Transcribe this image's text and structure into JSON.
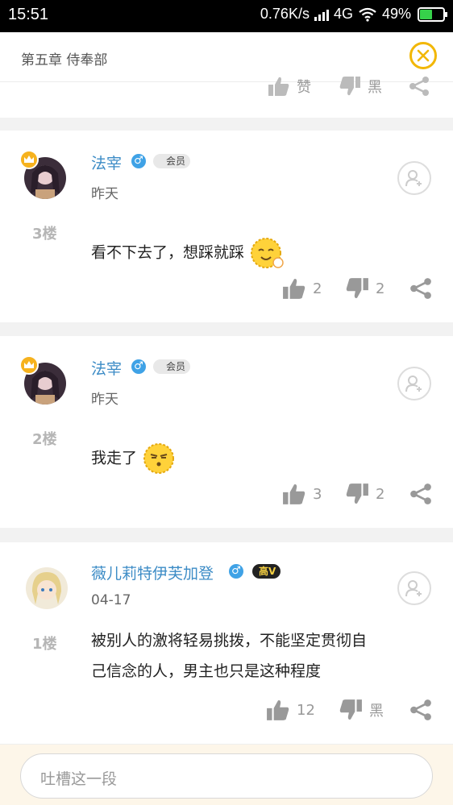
{
  "status_bar": {
    "time": "15:51",
    "network_speed": "0.76K/s",
    "network_type": "4G",
    "battery": "49%"
  },
  "header": {
    "title": "第五章 侍奉部"
  },
  "prev_card": {
    "like_label": "赞",
    "dislike_label": "黑"
  },
  "comments": [
    {
      "username": "法宰",
      "gender": "♂",
      "badge": "会员",
      "date": "昨天",
      "floor": "3楼",
      "text": "看不下去了，想踩就踩",
      "likes": "2",
      "dislikes": "2"
    },
    {
      "username": "法宰",
      "gender": "♂",
      "badge": "会员",
      "date": "昨天",
      "floor": "2楼",
      "text": "我走了",
      "likes": "3",
      "dislikes": "2"
    },
    {
      "username": "薇儿莉特伊芙加登",
      "gender": "♂",
      "badge": "高V",
      "date": "04-17",
      "floor": "1楼",
      "text_line1": "被别人的激将轻易挑拨，不能坚定贯彻自",
      "text_line2": "己信念的人，男主也只是这种程度",
      "likes": "12",
      "dislikes": "黑"
    }
  ],
  "input": {
    "placeholder": "吐槽这一段"
  },
  "colors": {
    "accent": "#f2b705",
    "username": "#3d8cc6",
    "input_bar": "#fdf6e9"
  }
}
